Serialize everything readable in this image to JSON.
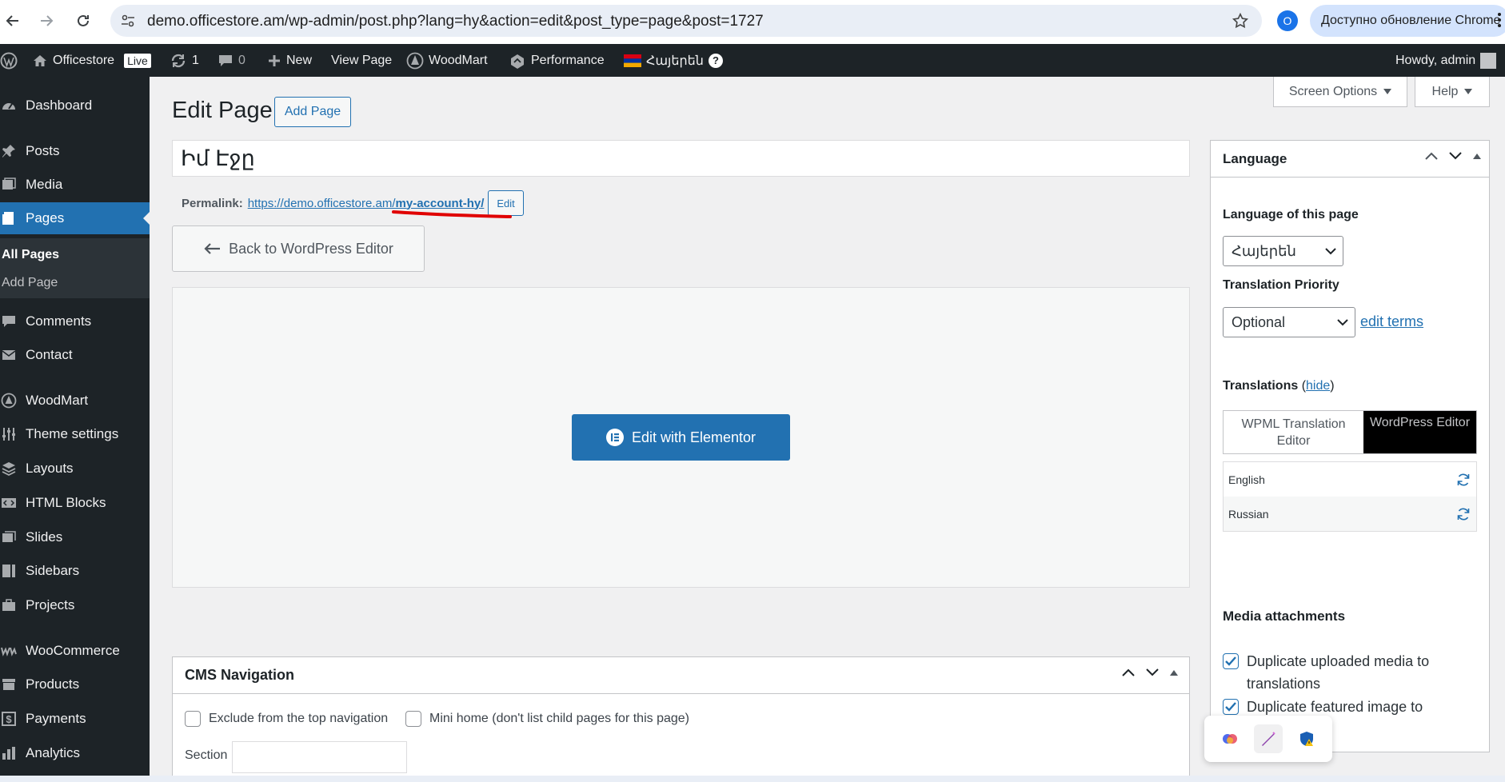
{
  "browser": {
    "url": "demo.officestore.am/wp-admin/post.php?lang=hy&action=edit&post_type=page&post=1727",
    "profile_initial": "O",
    "update_label": "Доступно обновление Chrome"
  },
  "adminbar": {
    "site_name": "Officestore",
    "live_badge": "Live",
    "updates_count": "1",
    "comments_count": "0",
    "new_label": "New",
    "view_page_label": "View Page",
    "woodmart_label": "WoodMart",
    "performance_label": "Performance",
    "language_label": "Հայերեն",
    "howdy_label": "Howdy, admin"
  },
  "sidebar": {
    "items": [
      {
        "label": "Dashboard",
        "icon": "dashboard-icon"
      },
      {
        "label": "Posts",
        "icon": "pin-icon"
      },
      {
        "label": "Media",
        "icon": "media-icon"
      },
      {
        "label": "Pages",
        "icon": "page-icon"
      },
      {
        "label": "Comments",
        "icon": "comment-icon"
      },
      {
        "label": "Contact",
        "icon": "mail-icon"
      },
      {
        "label": "WoodMart",
        "icon": "woodmart-icon"
      },
      {
        "label": "Theme settings",
        "icon": "sliders-icon"
      },
      {
        "label": "Layouts",
        "icon": "layers-icon"
      },
      {
        "label": "HTML Blocks",
        "icon": "code-icon"
      },
      {
        "label": "Slides",
        "icon": "slides-icon"
      },
      {
        "label": "Sidebars",
        "icon": "sidebar-icon"
      },
      {
        "label": "Projects",
        "icon": "briefcase-icon"
      },
      {
        "label": "WooCommerce",
        "icon": "woo-icon"
      },
      {
        "label": "Products",
        "icon": "archive-icon"
      },
      {
        "label": "Payments",
        "icon": "dollar-icon"
      },
      {
        "label": "Analytics",
        "icon": "bar-chart-icon"
      }
    ],
    "submenu": {
      "all_pages": "All Pages",
      "add_page": "Add Page"
    }
  },
  "main": {
    "page_title": "Edit Page",
    "add_page_label": "Add Page",
    "screen_options_label": "Screen Options",
    "help_label": "Help",
    "post_title_value": "Իմ Էջը",
    "permalink_label": "Permalink:",
    "permalink_base": "https://demo.officestore.am/",
    "permalink_slug": "my-account-hy/",
    "permalink_edit_label": "Edit",
    "back_button_label": "Back to WordPress Editor",
    "elementor_button_label": "Edit with Elementor",
    "accent_color": "#2271b1",
    "annotation_color": "#e00000"
  },
  "cms_navigation": {
    "title": "CMS Navigation",
    "exclude_label": "Exclude from the top navigation",
    "exclude_checked": false,
    "mini_home_label": "Mini home (don't list child pages for this page)",
    "mini_home_checked": false,
    "section_label": "Section",
    "section_value": ""
  },
  "language_box": {
    "title": "Language",
    "language_of_page_label": "Language of this page",
    "language_value": "Հայերեն",
    "translation_priority_label": "Translation Priority",
    "priority_value": "Optional",
    "edit_terms_label": "edit terms",
    "translations_label": "Translations",
    "hide_label": "hide",
    "tab_wpml": "WPML Translation Editor",
    "tab_wp": "WordPress Editor",
    "languages": [
      {
        "name": "English"
      },
      {
        "name": "Russian"
      }
    ],
    "media_title": "Media attachments",
    "media_options": [
      {
        "label": "Duplicate uploaded media to translations",
        "checked": true
      },
      {
        "label": "Duplicate featured image to",
        "checked": true
      }
    ]
  }
}
